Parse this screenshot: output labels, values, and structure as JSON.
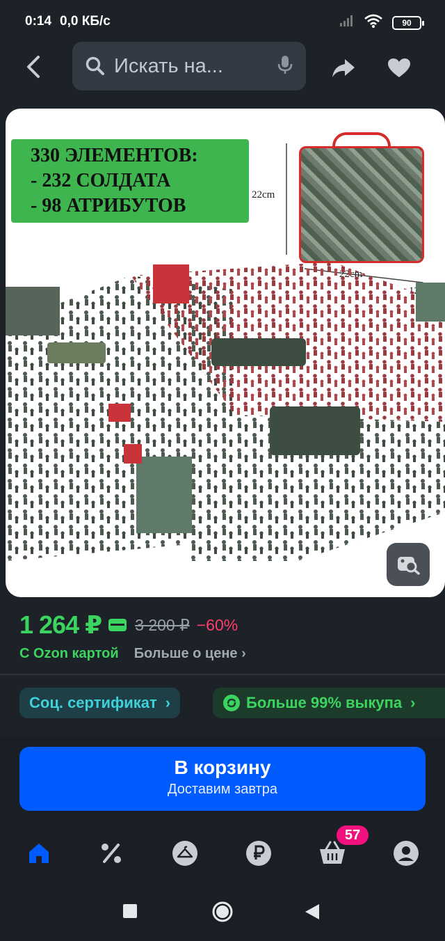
{
  "status_bar": {
    "time": "0:14",
    "net_speed": "0,0 КБ/с",
    "battery": "90"
  },
  "search": {
    "placeholder": "Искать на..."
  },
  "product_image": {
    "promo_line1": "330 ЭЛЕМЕНТОВ:",
    "promo_line2": "- 232 СОЛДАТА",
    "promo_line3": "- 98 АТРИБУТОВ",
    "dim_height": "22cm",
    "dim_width": "22cm",
    "dim_depth": "12cm"
  },
  "price": {
    "current": "1 264 ₽",
    "old": "3 200 ₽",
    "discount": "−60%",
    "ozon_card": "С Ozon картой",
    "more_about_price": "Больше о цене ›"
  },
  "chips": {
    "certificate": "Соц. сертификат",
    "buyout": "Больше 99% выкупа"
  },
  "cart_button": {
    "title": "В корзину",
    "subtitle": "Доставим завтра"
  },
  "nav": {
    "cart_badge": "57"
  },
  "colors": {
    "accent_blue": "#005bff",
    "price_green": "#3ad45f",
    "discount_pink": "#ff3d6b",
    "badge_pink": "#f1117e"
  }
}
